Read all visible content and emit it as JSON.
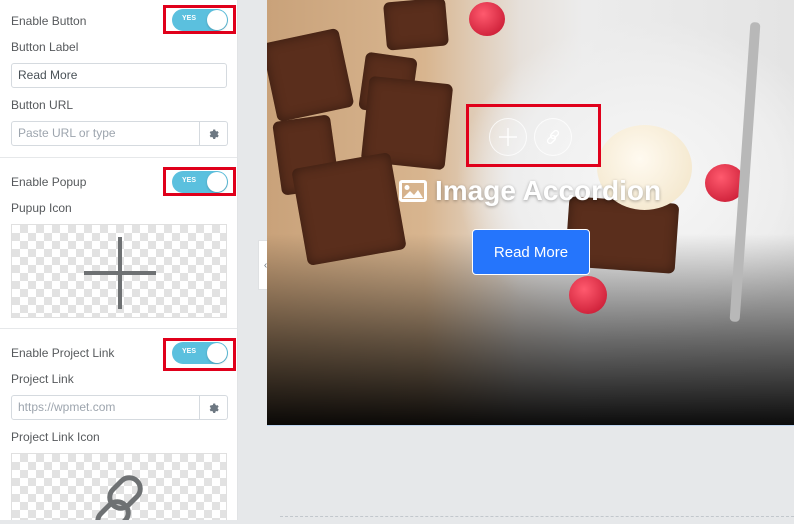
{
  "panel": {
    "enable_button_label": "Enable Button",
    "enable_button_toggle": "YES",
    "button_label_title": "Button Label",
    "button_label_value": "Read More",
    "button_url_title": "Button URL",
    "button_url_placeholder": "Paste URL or type",
    "enable_popup_label": "Enable Popup",
    "enable_popup_toggle": "YES",
    "popup_icon_title": "Pupup Icon",
    "enable_project_link_label": "Enable Project Link",
    "enable_project_link_toggle": "YES",
    "project_link_title": "Project Link",
    "project_link_placeholder": "https://wpmet.com",
    "project_link_icon_title": "Project Link Icon"
  },
  "preview": {
    "title": "Image Accordion",
    "button_label": "Read More"
  },
  "icons": [
    "gear-icon",
    "plus-icon",
    "link-icon",
    "image-icon",
    "chevron-left-icon"
  ],
  "colors": {
    "toggle_on": "#5bc0de",
    "highlight": "#e0001b",
    "button_blue": "#2575fc"
  }
}
